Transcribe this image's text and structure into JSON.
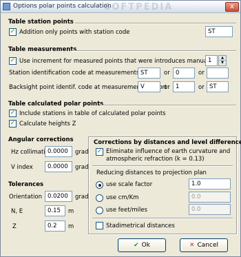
{
  "window": {
    "title": "Options polar points calculation",
    "watermark": "SOFTPEDIA",
    "close_glyph": "x"
  },
  "table_station_points": {
    "heading": "Table station points",
    "addition_only": {
      "label": "Addition only points with station code",
      "checked": true,
      "code": "ST"
    }
  },
  "table_measurements": {
    "heading": "Table measurements",
    "use_increment": {
      "label": "Use increment for measured points that were introduces manually",
      "checked": true,
      "value": "1"
    },
    "station_id": {
      "label": "Station identification code at measurements import",
      "v1": "ST",
      "or1": "or",
      "v2": "0",
      "or2": "or",
      "v3": ""
    },
    "backsight": {
      "label": "Backsight point identif. code at measurements import",
      "v1": "V",
      "or1": "or",
      "v2": "1",
      "or2": "or",
      "v3": "ST"
    }
  },
  "table_calculated": {
    "heading": "Table calculated polar points",
    "include_stations": {
      "label": "Include stations in table of calculated polar points",
      "checked": true
    },
    "calculate_heights": {
      "label": "Calculate heights Z",
      "checked": true
    }
  },
  "angular_corrections": {
    "heading": "Angular corrections",
    "hz": {
      "label": "Hz collimation",
      "value": "0.0000",
      "unit": "grad"
    },
    "v_index": {
      "label": "V index",
      "value": "0.0000",
      "unit": "grad"
    }
  },
  "tolerances": {
    "heading": "Tolerances",
    "orientation": {
      "label": "Orientation",
      "value": "0.0200",
      "unit": "grad"
    },
    "ne": {
      "label": "N, E",
      "value": "0.15",
      "unit": "m"
    },
    "z": {
      "label": "Z",
      "value": "0.2",
      "unit": "m"
    }
  },
  "corrections": {
    "heading": "Corrections by distances and level differences",
    "eliminate": {
      "label_line1": "Eliminate influence of earth curvature and",
      "label_line2": "atmospheric refraction (k = 0.13)",
      "checked": true
    },
    "reducing_label": "Reducing distances to projection plan",
    "options": [
      {
        "label": "use scale factor",
        "value": "1.0",
        "selected": true
      },
      {
        "label": "use cm/Km",
        "value": "0.0",
        "selected": false
      },
      {
        "label": "use feet/miles",
        "value": "0.0",
        "selected": false
      }
    ],
    "stadimetrical": {
      "label": "Stadimetrical distances",
      "checked": false
    }
  },
  "buttons": {
    "ok": "Ok",
    "cancel": "Cancel"
  },
  "glyphs": {
    "check": "✓",
    "ok_check": "✔",
    "cancel_x": "✕",
    "spin_up": "▲",
    "spin_down": "▼"
  }
}
